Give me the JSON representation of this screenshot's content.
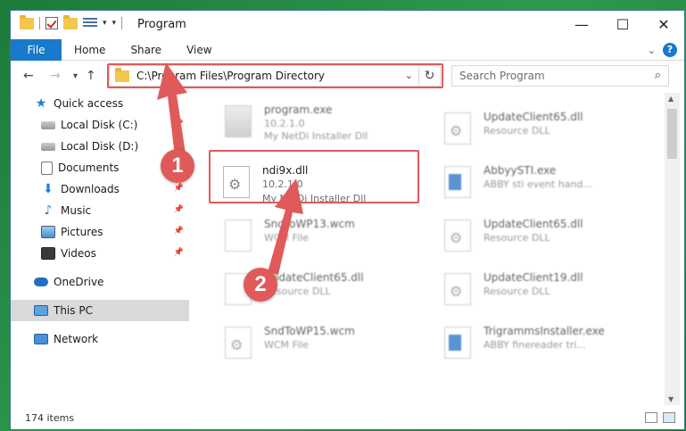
{
  "window": {
    "title": "Program",
    "controls": {
      "minimize": "—",
      "maximize": "☐",
      "close": "✕"
    }
  },
  "ribbon": {
    "tabs": [
      "File",
      "Home",
      "Share",
      "View"
    ]
  },
  "address": {
    "path": "C:\\Program Files\\Program Directory",
    "refresh": "↻"
  },
  "search": {
    "placeholder": "Search Program"
  },
  "sidebar": {
    "items": [
      {
        "label": "Quick access",
        "icon": "star-icon"
      },
      {
        "label": "Local Disk (C:)",
        "icon": "disk-icon"
      },
      {
        "label": "Local Disk (D:)",
        "icon": "disk-icon"
      },
      {
        "label": "Documents",
        "icon": "documents-icon"
      },
      {
        "label": "Downloads",
        "icon": "downloads-icon"
      },
      {
        "label": "Music",
        "icon": "music-icon"
      },
      {
        "label": "Pictures",
        "icon": "pictures-icon"
      },
      {
        "label": "Videos",
        "icon": "videos-icon"
      },
      {
        "label": "OneDrive",
        "icon": "onedrive-icon"
      },
      {
        "label": "This PC",
        "icon": "this-pc-icon"
      },
      {
        "label": "Network",
        "icon": "network-icon"
      }
    ]
  },
  "files": {
    "left": [
      {
        "name": "program.exe",
        "line1": "10.2.1.0",
        "line2": "My NetDi Installer Dll"
      },
      {
        "name": "ndi9x.dll",
        "line1": "10.2.1.0",
        "line2": "My NetDi Installer Dll"
      },
      {
        "name": "SndToWP13.wcm",
        "line1": "WCM File"
      },
      {
        "name": "UpdateClient65.dll",
        "line1": "Resource DLL"
      },
      {
        "name": "SndToWP15.wcm",
        "line1": "WCM File"
      }
    ],
    "right": [
      {
        "name": "UpdateClient65.dll",
        "line1": "Resource DLL"
      },
      {
        "name": "AbbyySTI.exe",
        "line1": "ABBY sti event hand..."
      },
      {
        "name": "UpdateClient65.dll",
        "line1": "Resource DLL"
      },
      {
        "name": "UpdateClient19.dll",
        "line1": "Resource DLL"
      },
      {
        "name": "TrigrammsInstaller.exe",
        "line1": "ABBY finereader tri..."
      }
    ]
  },
  "status": {
    "items_count": "174 items"
  },
  "callouts": [
    "1",
    "2"
  ],
  "colors": {
    "accent": "#1979ca",
    "highlight": "#e05a5a",
    "desktop": "#2f9a4e"
  }
}
